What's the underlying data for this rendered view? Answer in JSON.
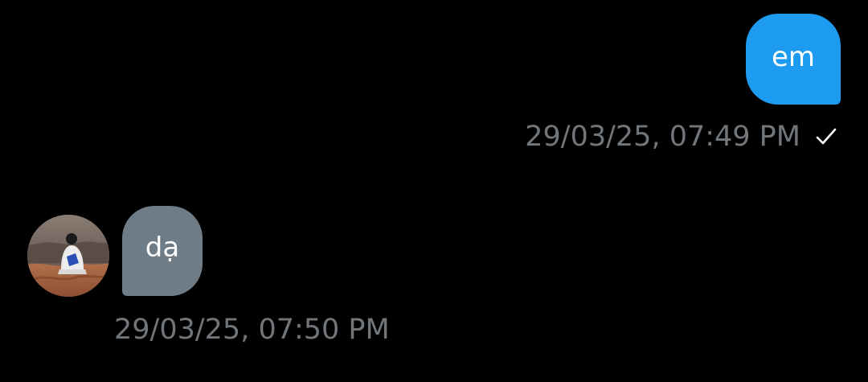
{
  "conversation": {
    "messages": [
      {
        "direction": "outgoing",
        "text": "em",
        "timestamp": "29/03/25, 07:49 PM",
        "status_icon": "check-icon"
      },
      {
        "direction": "incoming",
        "text": "dạ",
        "timestamp": "29/03/25, 07:50 PM",
        "sender_avatar": "avatar"
      }
    ]
  },
  "colors": {
    "background": "#000000",
    "outgoing_bubble": "#1d9bf0",
    "incoming_bubble": "#6e7c88",
    "timestamp_text": "#71767b",
    "message_text": "#ffffff"
  }
}
